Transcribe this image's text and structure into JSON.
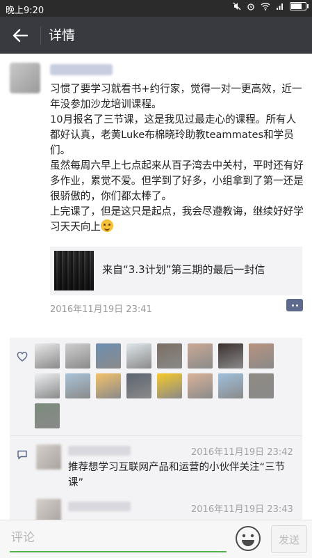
{
  "statusbar": {
    "time": "晚上9:20",
    "battery_level": 0.7
  },
  "titlebar": {
    "title": "详情"
  },
  "post": {
    "paragraphs": [
      "习惯了要学习就看书+约行家，觉得一对一更高效，近一年没参加沙龙培训课程。",
      "10月报名了三节课，这是我见过最走心的课程。所有人都好认真，老黄Luke布棉晓玲助教teammates和学员们。",
      "虽然每周六早上七点起来从百子湾去中关村，平时还有好多作业，累觉不爱。但学到了好多，小组拿到了第一还是很骄傲的，你们都太棒了。",
      "上完课了，但是这只是起点，我会尽遵教诲，继续好好学习天天向上"
    ],
    "link_title": "来自“3.3计划”第三期的最后一封信",
    "time": "2016年11月19日 23:41"
  },
  "likes": {
    "avatars": [
      "#e9e9e9",
      "#cfcfcf",
      "#6e8fb0",
      "#dfe6ea",
      "#7a6e64",
      "#c9a995",
      "#3c3030",
      "#b7927e",
      "#eef0f2",
      "#a9c3d8",
      "#f2c16a",
      "#5c6470",
      "#f6c92a",
      "#d9b29a",
      "#9fc0dc",
      "#8f8a84",
      "#7b8b7c"
    ]
  },
  "comments": [
    {
      "time": "2016年11月19日 23:42",
      "text": "推荐想学习互联网产品和运营的小伙伴关注“三节课”"
    },
    {
      "time": "2016年11月19日 23:43",
      "text": ""
    }
  ],
  "bottombar": {
    "placeholder": "评论",
    "send_label": "发送"
  }
}
